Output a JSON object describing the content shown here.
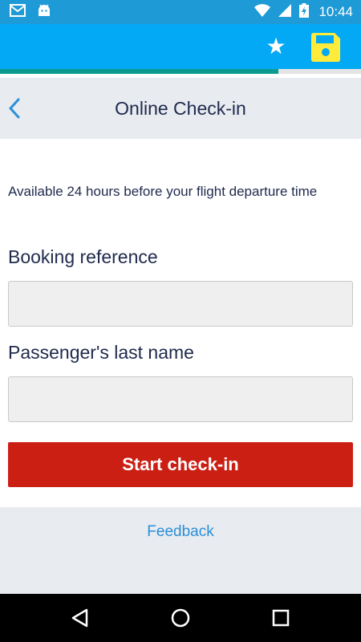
{
  "status_bar": {
    "time": "10:44",
    "icons": [
      "gmail-icon",
      "android-icon",
      "wifi-icon",
      "signal-icon",
      "battery-charging-icon"
    ]
  },
  "app_bar": {
    "icons": [
      "star-icon",
      "save-icon"
    ],
    "star_glyph": "★"
  },
  "progress": {
    "fraction": 0.77
  },
  "header": {
    "title": "Online Check-in",
    "back_icon": "chevron-left-icon"
  },
  "content": {
    "availability_text": "Available 24 hours before your flight departure time",
    "booking_reference": {
      "label": "Booking reference",
      "value": "",
      "placeholder": ""
    },
    "last_name": {
      "label": "Passenger's last name",
      "value": "",
      "placeholder": ""
    },
    "start_button_label": "Start check-in"
  },
  "footer": {
    "feedback_label": "Feedback"
  },
  "nav_bar": {
    "icons": [
      "back-triangle-icon",
      "home-circle-icon",
      "recents-square-icon"
    ]
  },
  "colors": {
    "status_bar": "#1e9ad6",
    "app_bar": "#03a9f4",
    "progress": "#0c9a8f",
    "primary_button": "#cc1f14",
    "link": "#2b8fd9",
    "text": "#1f2a4d",
    "save_icon": "#ffeb3b"
  }
}
